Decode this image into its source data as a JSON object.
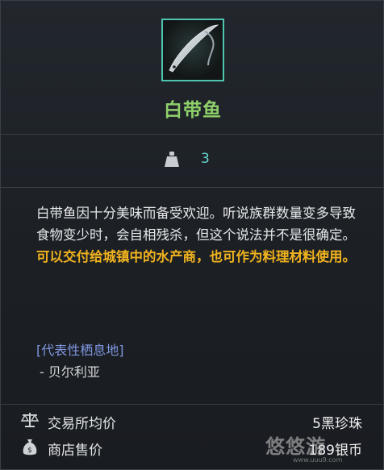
{
  "item": {
    "icon": "ribbonfish-icon",
    "name": "白带鱼",
    "weight": "3"
  },
  "description": {
    "line_normal": "白带鱼因十分美味而备受欢迎。听说族群数量变多导致食物变少时，会自相残杀，但这个说法并不是很确定。",
    "line_highlight": "可以交付给城镇中的水产商，也可作为料理材料使用。"
  },
  "habitat": {
    "title": "[代表性栖息地]",
    "items": [
      "- 贝尔利亚"
    ]
  },
  "prices": [
    {
      "label": "交易所均价",
      "value": "5黑珍珠",
      "icon": "scale-icon"
    },
    {
      "label": "商店售价",
      "value": "189银币",
      "icon": "money-bag-icon"
    }
  ],
  "watermark": {
    "text": "悠悠游",
    "sub": "www.uuu9.com"
  },
  "colors": {
    "name": "#8fd06a",
    "weight": "#67d4cf",
    "highlight": "#f0b21e",
    "habitat_title": "#7f97e0",
    "icon_border": "#4fc5b0"
  }
}
